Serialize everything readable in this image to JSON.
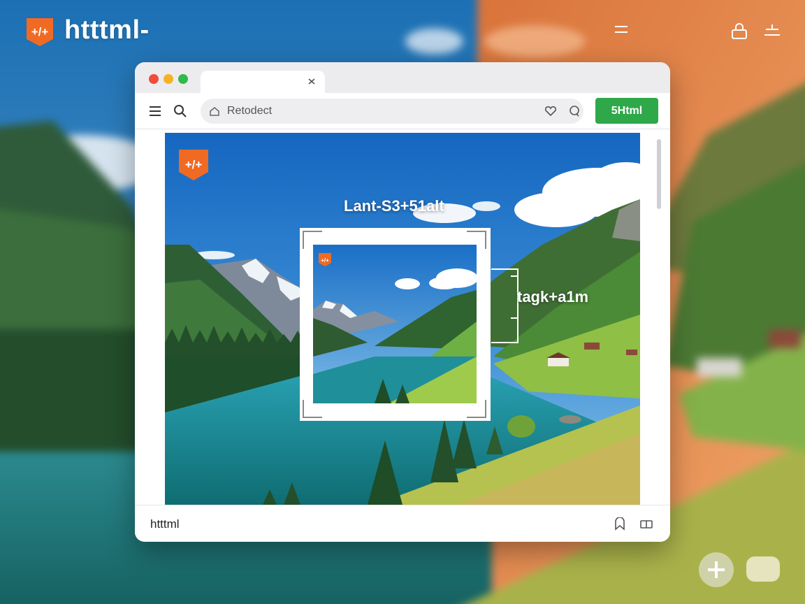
{
  "app": {
    "title": "htttml-",
    "logo_glyph": "+/+"
  },
  "browser": {
    "tab_close_glyph": "x",
    "url_text": "Retodect",
    "go_button_label": "5Html",
    "status_text": "htttml"
  },
  "hero": {
    "logo_glyph": "+/+",
    "title_text": "Lant-S3+51alt",
    "caption_text": "tagk+a1m"
  },
  "colors": {
    "accent": "#f06a23",
    "go_button": "#2fa84a",
    "traffic_close": "#f04c3c",
    "traffic_minimize": "#f5b324",
    "traffic_maximize": "#31b94a"
  },
  "icons": {
    "top_bar": [
      "menu-lines-icon",
      "lock-icon",
      "equalizer-icon"
    ],
    "toolbar": [
      "hamburger-icon",
      "search-icon",
      "home-icon",
      "heart-icon",
      "chat-icon"
    ],
    "status_bar": [
      "bookmark-icon",
      "book-icon"
    ],
    "floating": [
      "plus-icon",
      "pill-button"
    ]
  }
}
